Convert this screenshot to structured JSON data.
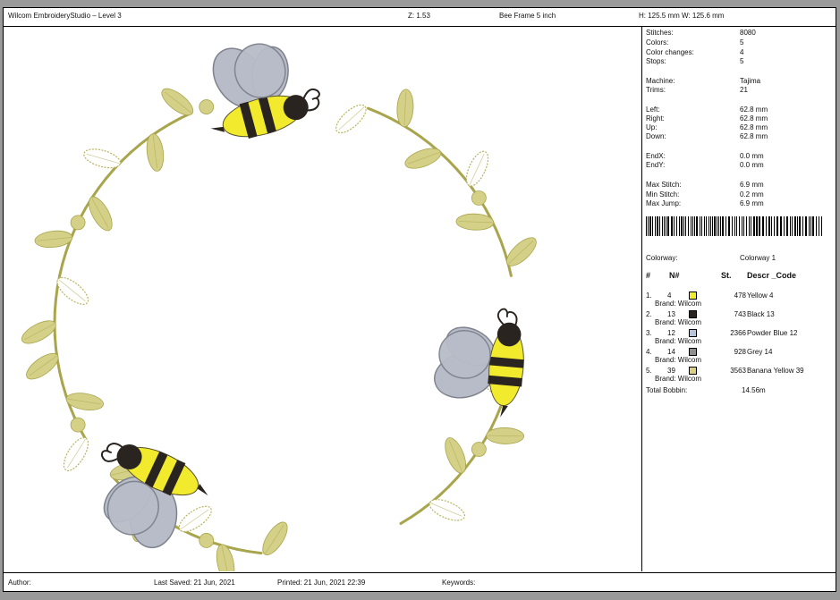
{
  "header": {
    "app_title": "Wilcom EmbroideryStudio – Level 3",
    "zoom": "Z: 1.53",
    "design_name": "Bee Frame 5 inch",
    "dimensions": "H: 125.5 mm   W: 125.6 mm"
  },
  "stats": [
    {
      "label": "Stitches:",
      "value": "8080"
    },
    {
      "label": "Colors:",
      "value": "5"
    },
    {
      "label": "Color changes:",
      "value": "4"
    },
    {
      "label": "Stops:",
      "value": "5"
    },
    {
      "label": "Machine:",
      "value": "Tajima"
    },
    {
      "label": "Trims:",
      "value": "21"
    },
    {
      "label": "Left:",
      "value": "62.8 mm"
    },
    {
      "label": "Right:",
      "value": "62.8 mm"
    },
    {
      "label": "Up:",
      "value": "62.8 mm"
    },
    {
      "label": "Down:",
      "value": "62.8 mm"
    },
    {
      "label": "EndX:",
      "value": "0.0 mm"
    },
    {
      "label": "EndY:",
      "value": "0.0 mm"
    },
    {
      "label": "Max Stitch:",
      "value": "6.9 mm"
    },
    {
      "label": "Min Stitch:",
      "value": "0.2 mm"
    },
    {
      "label": "Max Jump:",
      "value": "6.9 mm"
    }
  ],
  "colorway": {
    "label": "Colorway:",
    "value": "Colorway 1"
  },
  "color_table": {
    "headers": {
      "num": "#",
      "n": "N#",
      "st": "St.",
      "descr": "Descr _Code"
    },
    "rows": [
      {
        "num": "1.",
        "n": "4",
        "color": "#f2ea2c",
        "stitches": "478",
        "descr": "Yellow 4",
        "brand": "Brand: Wilcom"
      },
      {
        "num": "2.",
        "n": "13",
        "color": "#2a2420",
        "stitches": "743",
        "descr": "Black 13",
        "brand": "Brand: Wilcom"
      },
      {
        "num": "3.",
        "n": "12",
        "color": "#b8c4dc",
        "stitches": "2366",
        "descr": "Powder Blue 12",
        "brand": "Brand: Wilcom"
      },
      {
        "num": "4.",
        "n": "14",
        "color": "#8e8e8e",
        "stitches": "928",
        "descr": "Grey 14",
        "brand": "Brand: Wilcom"
      },
      {
        "num": "5.",
        "n": "39",
        "color": "#d8cf80",
        "stitches": "3563",
        "descr": "Banana Yellow 39",
        "brand": "Brand: Wilcom"
      }
    ]
  },
  "total_bobbin": {
    "label": "Total Bobbin:",
    "value": "14.56m"
  },
  "footer": {
    "author": "Author:",
    "last_saved": "Last Saved: 21 Jun, 2021",
    "printed": "Printed: 21 Jun, 2021 22:39",
    "keywords": "Keywords:"
  },
  "design_colors": {
    "leaf_fill": "#d4d088",
    "leaf_stroke": "#a8a54c",
    "leaf_outline": "#b7b35e",
    "wing_fill": "#b8bcc8",
    "wing_stroke": "#7e828c",
    "bee_yellow": "#f2ea2c",
    "bee_black": "#2a2420"
  }
}
